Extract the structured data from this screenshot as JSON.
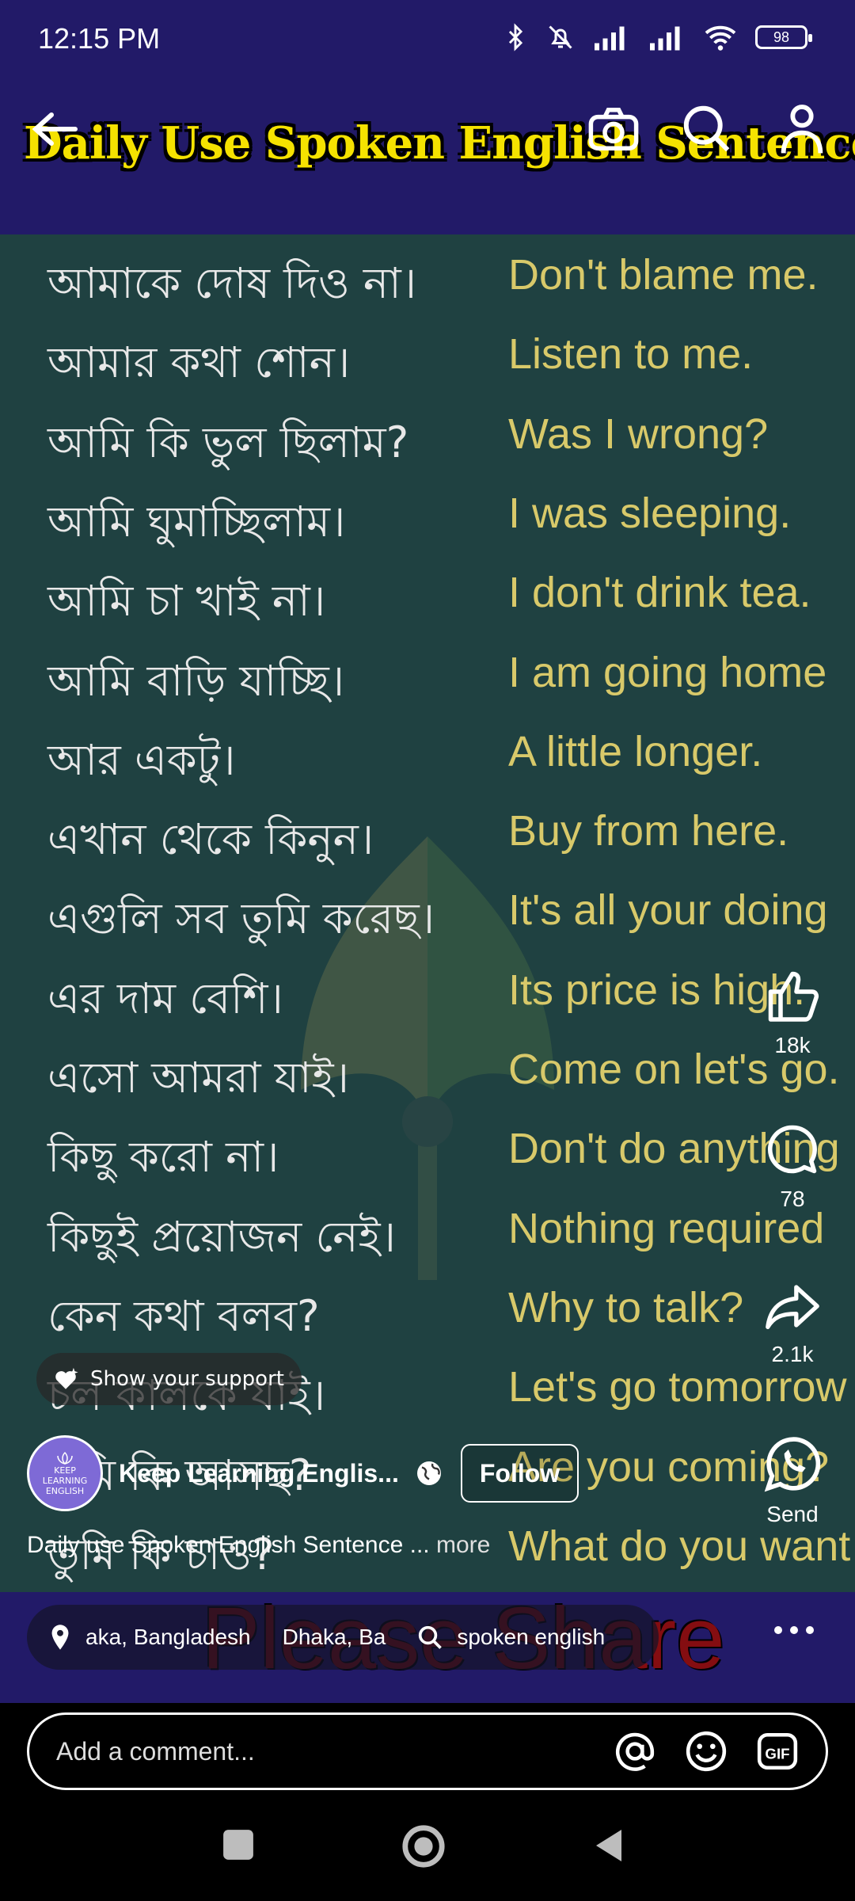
{
  "status_bar": {
    "time": "12:15 PM",
    "battery": "98",
    "icons": [
      "bluetooth-icon",
      "mute-icon",
      "signal-icon",
      "signal-icon",
      "wifi-icon",
      "battery-icon"
    ]
  },
  "header": {
    "video_title": "Daily Use Spoken English Sentence",
    "back_icon": "back-arrow-icon",
    "camera_icon": "camera-icon",
    "search_icon": "search-icon",
    "profile_icon": "profile-icon"
  },
  "sentences": [
    {
      "bn": "আমাকে দোষ দিও না।",
      "en": "Don't blame me."
    },
    {
      "bn": "আমার কথা শোন।",
      "en": "Listen to me."
    },
    {
      "bn": "আমি কি ভুল ছিলাম?",
      "en": "Was I wrong?"
    },
    {
      "bn": "আমি ঘুমাচ্ছিলাম।",
      "en": "I was sleeping."
    },
    {
      "bn": "আমি চা খাই না।",
      "en": "I don't drink tea."
    },
    {
      "bn": "আমি বাড়ি যাচ্ছি।",
      "en": "I am going home"
    },
    {
      "bn": "আর একটু।",
      "en": "A little longer."
    },
    {
      "bn": "এখান থেকে কিনুন।",
      "en": "Buy from here."
    },
    {
      "bn": "এগুলি সব তুমি করেছ।",
      "en": "It's all your doing"
    },
    {
      "bn": "এর দাম বেশি।",
      "en": "Its price is high."
    },
    {
      "bn": "এসো আমরা যাই।",
      "en": "Come on let's go."
    },
    {
      "bn": "কিছু করো না।",
      "en": "Don't do anything"
    },
    {
      "bn": "কিছুই প্রয়োজন নেই।",
      "en": "Nothing required"
    },
    {
      "bn": "কেন কথা বলব?",
      "en": "Why to talk?"
    },
    {
      "bn": "চল কালকে যাই।",
      "en": "Let's go tomorrow"
    },
    {
      "bn": "তুমি কি আসছ?",
      "en": "Are you coming?"
    },
    {
      "bn": "তুমি কি চাও?",
      "en": "What do you want"
    }
  ],
  "overlay": {
    "please_share": "Please Share",
    "support_label": "Show your support",
    "author_name": "Keep Learning Englis...",
    "avatar_text": [
      "KEEP",
      "LEARNING",
      "ENGLISH"
    ],
    "follow_label": "Follow",
    "caption": "Daily use Spoken English Sentence ...",
    "caption_more": "more"
  },
  "actions": {
    "likes": "18k",
    "comments": "78",
    "shares": "2.1k",
    "send_label": "Send"
  },
  "chips": {
    "location_1": "aka, Bangladesh",
    "location_2": "Dhaka, Ba",
    "search_term": "spoken english"
  },
  "comment": {
    "placeholder": "Add a comment..."
  },
  "colors": {
    "header_bg": "#221a68",
    "video_bg": "#1f4141",
    "title_yellow": "#f5e200",
    "english_text": "#d8c96a",
    "share_red": "#8a0d0d"
  }
}
